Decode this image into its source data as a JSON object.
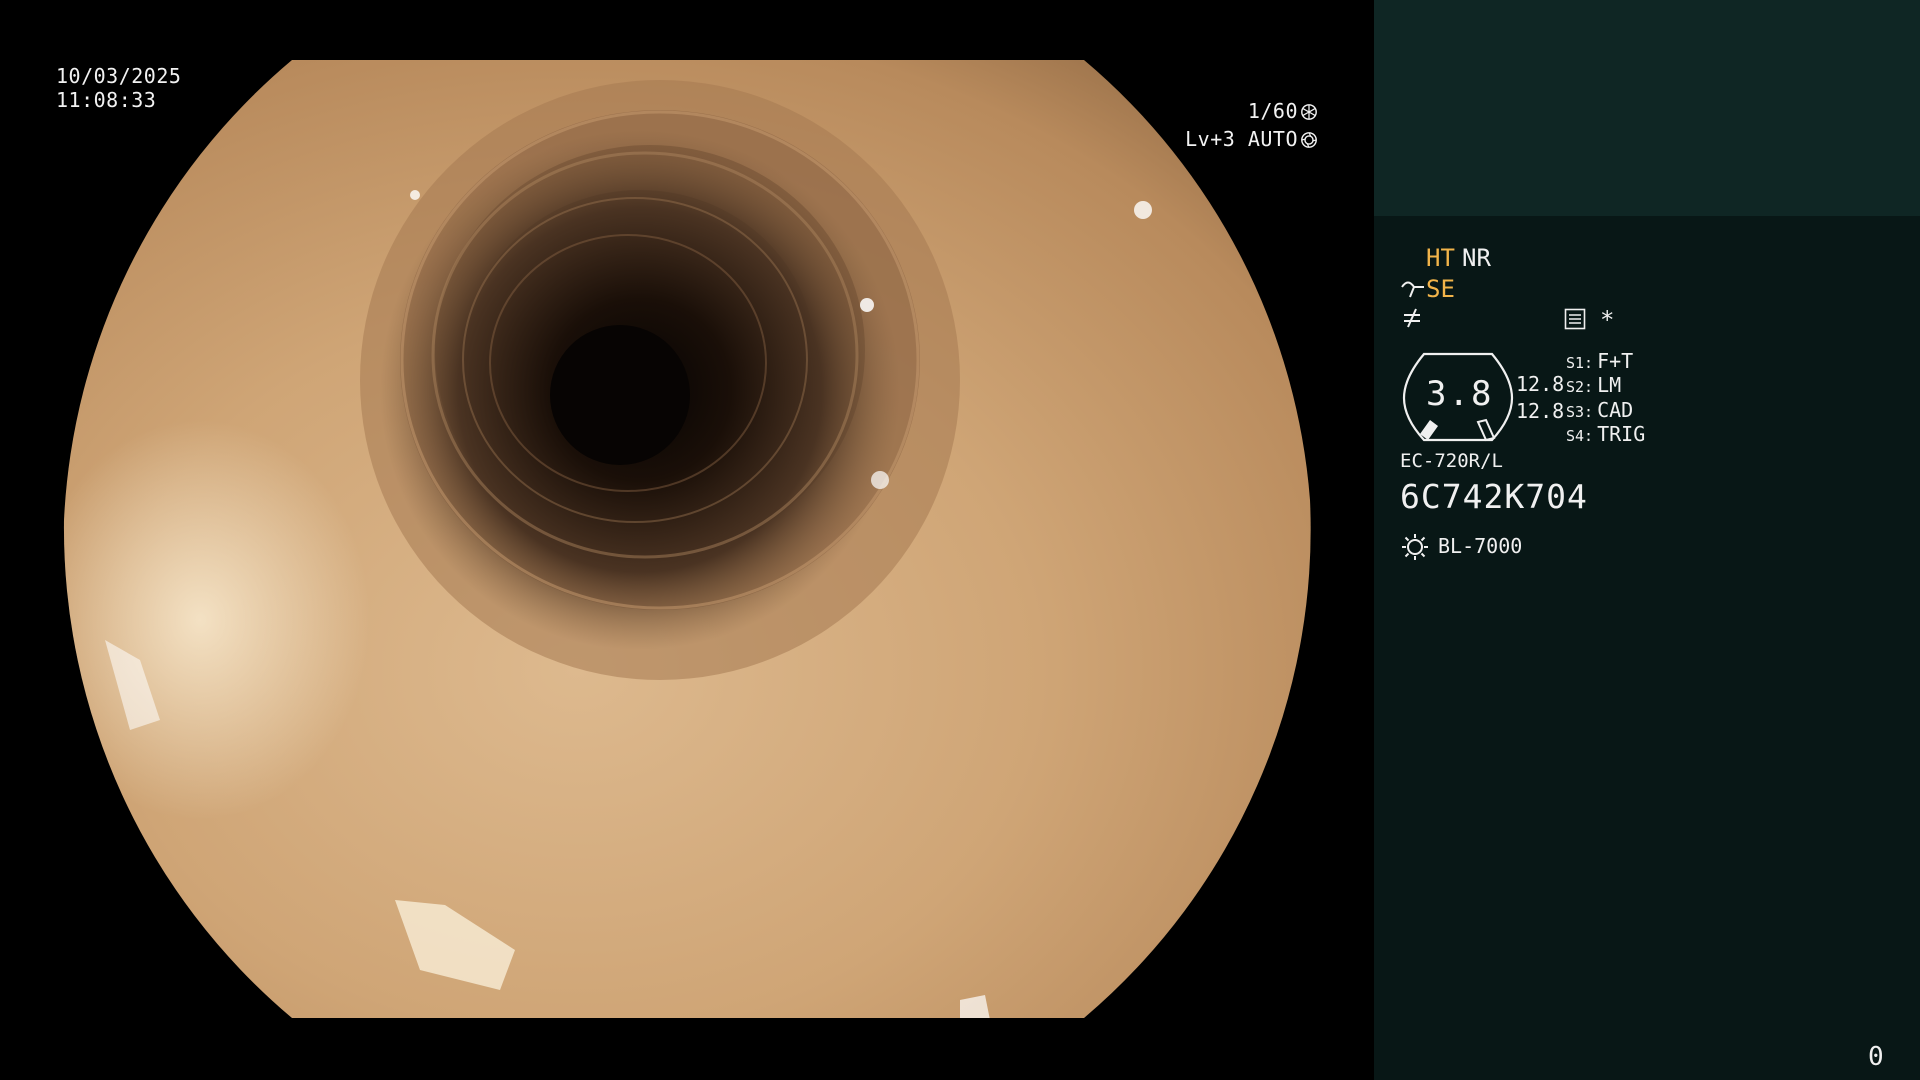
{
  "overlay": {
    "date": "10/03/2025",
    "time": "11:08:33",
    "shutter_speed": "1/60",
    "shutter_icon": "aperture-icon",
    "iris_mode": "Lv+3 AUTO",
    "iris_icon": "iris-icon"
  },
  "panel": {
    "colors": {
      "accent": "#f2b44a",
      "text": "#f0f0f0",
      "panel_bg": "#081716",
      "panel_top_bg": "#0f2624"
    },
    "enhancement": {
      "ht": "HT",
      "nr": "NR",
      "se": "SE",
      "se_icon": "structure-enhance-icon",
      "structure_icon": "not-equal-icon",
      "menu_icon": "menu-list-icon",
      "star": "*"
    },
    "gauge": {
      "value": "3.8",
      "icon": "scope-gauge-icon"
    },
    "levels": {
      "a": "12.8",
      "b": "12.8"
    },
    "switches": [
      {
        "key": "S1:",
        "value": "F+T"
      },
      {
        "key": "S2:",
        "value": "LM"
      },
      {
        "key": "S3:",
        "value": "CAD"
      },
      {
        "key": "S4:",
        "value": "TRIG"
      }
    ],
    "scope_model": "EC-720R/L",
    "scope_serial": "6C742K704",
    "light_source_icon": "light-bulb-icon",
    "light_source": "BL-7000",
    "counter": "0"
  }
}
